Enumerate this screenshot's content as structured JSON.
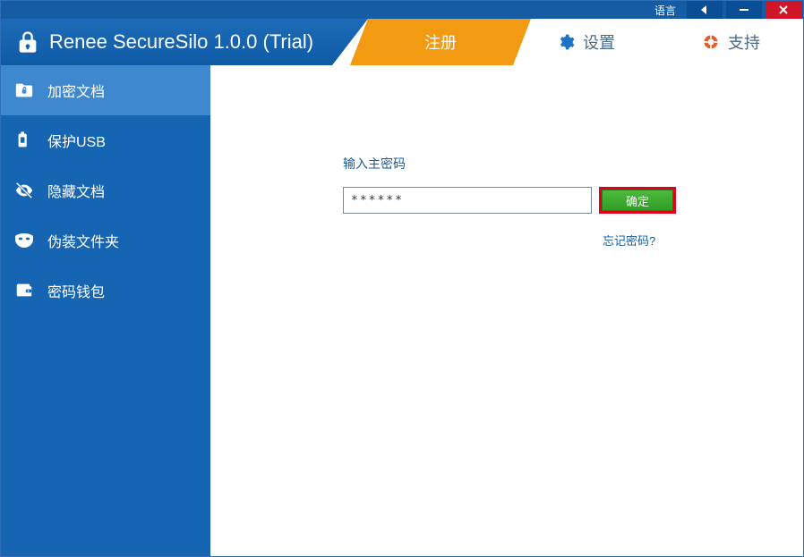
{
  "topbar": {
    "language_label": "语言"
  },
  "header": {
    "title": "Renee SecureSilo 1.0.0 (Trial)",
    "tabs": {
      "register": "注册",
      "settings": "设置",
      "support": "支持"
    }
  },
  "sidebar": {
    "items": [
      {
        "label": "加密文档"
      },
      {
        "label": "保护USB"
      },
      {
        "label": "隐藏文档"
      },
      {
        "label": "伪装文件夹"
      },
      {
        "label": "密码钱包"
      }
    ]
  },
  "main": {
    "password_prompt": "输入主密码",
    "password_value": "******",
    "ok_button": "确定",
    "forgot_link": "忘记密码?"
  },
  "colors": {
    "brand_blue": "#155ca2",
    "sidebar_blue": "#1565b2",
    "active_sidebar": "#3e88cf",
    "accent_orange": "#f29a12",
    "ok_green": "#3aa82d",
    "highlight_red": "#e1001a",
    "close_red": "#d11528"
  }
}
